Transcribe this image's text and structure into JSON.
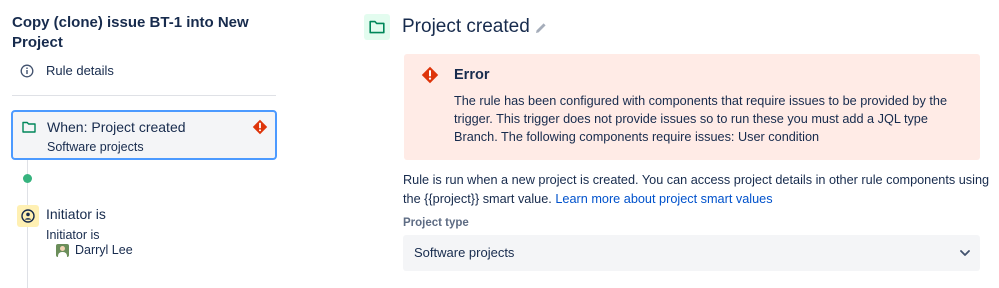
{
  "left_panel": {
    "rule_title": "Copy (clone) issue BT-1 into New Project",
    "rule_details_label": "Rule details",
    "trigger": {
      "title": "When: Project created",
      "subtitle": "Software projects",
      "status": "error"
    },
    "condition": {
      "title": "Initiator is",
      "subtitle": "Initiator is",
      "user_name": "Darryl Lee"
    }
  },
  "right_panel": {
    "title": "Project created",
    "error": {
      "title": "Error",
      "message": "The rule has been configured with components that require issues to be provided by the trigger. This trigger does not provide issues so to run these you must add a JQL type Branch. The following components require issues: User condition"
    },
    "description": "Rule is run when a new project is created. You can access project details in other rule components using the {{project}} smart value.",
    "description_link": "Learn more about project smart values",
    "project_type_label": "Project type",
    "project_type_value": "Software projects"
  },
  "colors": {
    "accent_border": "#4c9aff",
    "error_bg": "#ffebe6",
    "error_icon": "#de350b",
    "success_dot": "#36b37e",
    "link": "#0052cc",
    "trigger_icon_green": "#00875a",
    "condition_icon_bg": "#fff0b3"
  },
  "icons": {
    "rule_details": "info-icon",
    "trigger": "folder-icon",
    "trigger_status": "error-icon",
    "condition": "user-condition-icon",
    "header": "folder-icon",
    "edit": "pencil-icon",
    "select": "chevron-down-icon"
  }
}
